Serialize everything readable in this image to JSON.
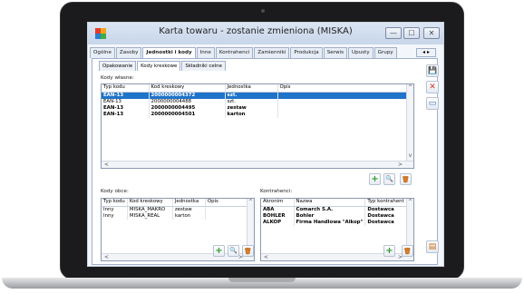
{
  "window": {
    "title": "Karta towaru - zostanie zmieniona (MISKA)",
    "minimize": "—",
    "maximize": "☐",
    "close": "✕"
  },
  "tabs": [
    {
      "label": "Ogólne"
    },
    {
      "label": "Zasoby"
    },
    {
      "label": "Jednostki i kody"
    },
    {
      "label": "Inne"
    },
    {
      "label": "Kontrahenci"
    },
    {
      "label": "Zamienniki"
    },
    {
      "label": "Produkcja"
    },
    {
      "label": "Serwis"
    },
    {
      "label": "Upusty"
    },
    {
      "label": "Grupy"
    }
  ],
  "nav_arrows": "◂ ▸",
  "subtabs": [
    {
      "label": "Opakowanie"
    },
    {
      "label": "Kody kreskowe"
    },
    {
      "label": "Składniki celne"
    }
  ],
  "own_codes": {
    "label": "Kody własne:",
    "columns": [
      "Typ kodu",
      "Kod kreskowy",
      "Jednostka",
      "Opis"
    ],
    "rows": [
      {
        "type": "EAN-13",
        "code": "2000000004372",
        "unit": "szt.",
        "desc": ""
      },
      {
        "type": "EAN-13",
        "code": "2000000004488",
        "unit": "szt.",
        "desc": ""
      },
      {
        "type": "EAN-13",
        "code": "2000000004495",
        "unit": "zestaw",
        "desc": ""
      },
      {
        "type": "EAN-13",
        "code": "2000000004501",
        "unit": "karton",
        "desc": ""
      }
    ]
  },
  "foreign_codes": {
    "label": "Kody obce:",
    "columns": [
      "Typ kodu",
      "Kod kreskowy",
      "Jednostka",
      "Opis"
    ],
    "rows": [
      {
        "type": "Inny",
        "code": "MISKA_MAKRO",
        "unit": "zestaw",
        "desc": ""
      },
      {
        "type": "Inny",
        "code": "MISKA_REAL",
        "unit": "karton",
        "desc": ""
      }
    ]
  },
  "contractors": {
    "label": "Kontrahenci:",
    "columns": [
      "Akronim",
      "Nazwa",
      "Typ kontrahent"
    ],
    "rows": [
      {
        "acronym": "ABA",
        "name": "Comarch S.A.",
        "type": "Dostawca"
      },
      {
        "acronym": "BOHLER",
        "name": "Bohler",
        "type": "Dostawca"
      },
      {
        "acronym": "ALKOP",
        "name": "Firma Handlowa \"Alkop\"",
        "type": "Dostawca"
      }
    ]
  },
  "icons": {
    "add": "+",
    "search": "🔍",
    "delete": "🗑",
    "save": "💾",
    "cancel": "✕",
    "minimize_panel": "▭"
  },
  "colors": {
    "selection": "#1f73c9",
    "add_green": "#2e9a2e",
    "cancel_red": "#d9342b"
  }
}
